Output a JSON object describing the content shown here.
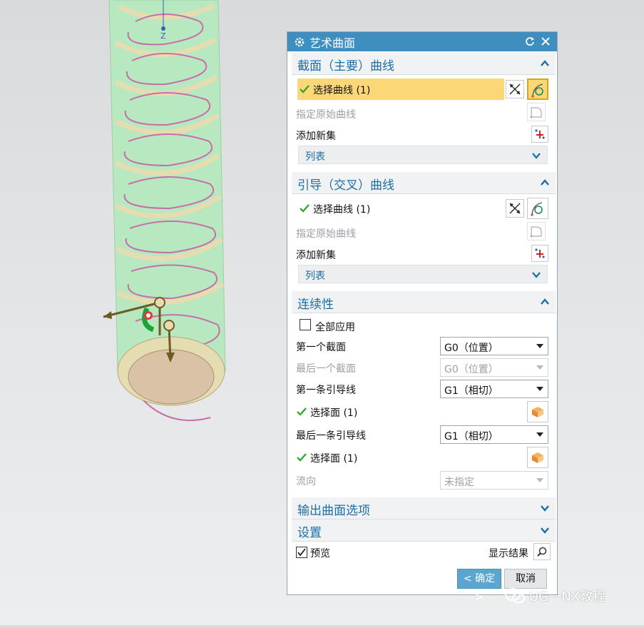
{
  "viewport": {
    "axis_label": "Z",
    "colors": {
      "pipe": "#b8e8c0",
      "coil": "#c86ea8",
      "band": "#e6dcb2",
      "handle": "#6f5a24"
    }
  },
  "dialog": {
    "title": "艺术曲面",
    "sections": {
      "section_curves": {
        "title": "截面（主要）曲线",
        "select_label": "选择曲线 (1)",
        "original_label": "指定原始曲线",
        "add_set_label": "添加新集",
        "list_label": "列表"
      },
      "guide_curves": {
        "title": "引导（交叉）曲线",
        "select_label": "选择曲线 (1)",
        "original_label": "指定原始曲线",
        "add_set_label": "添加新集",
        "list_label": "列表"
      },
      "continuity": {
        "title": "连续性",
        "apply_all_label": "全部应用",
        "apply_all_checked": false,
        "first_section_label": "第一个截面",
        "first_section_value": "G0（位置）",
        "last_section_label": "最后一个截面",
        "last_section_value": "G0（位置）",
        "first_guide_label": "第一条引导线",
        "first_guide_value": "G1（相切）",
        "first_guide_face_label": "选择面 (1)",
        "last_guide_label": "最后一条引导线",
        "last_guide_value": "G1（相切）",
        "last_guide_face_label": "选择面 (1)",
        "flow_label": "流向",
        "flow_value": "未指定"
      },
      "output_options": {
        "title": "输出曲面选项"
      },
      "settings": {
        "title": "设置"
      }
    },
    "preview_label": "预览",
    "preview_checked": true,
    "show_result_label": "显示结果",
    "ok_label": "< 确定 >",
    "cancel_label": "取消"
  },
  "watermark": {
    "text": "UG一NX教程"
  },
  "colors": {
    "title_bar": "#3e8fc0",
    "section_title": "#1d6ea6",
    "active_row": "#fbd777",
    "check": "#2aa12a"
  }
}
